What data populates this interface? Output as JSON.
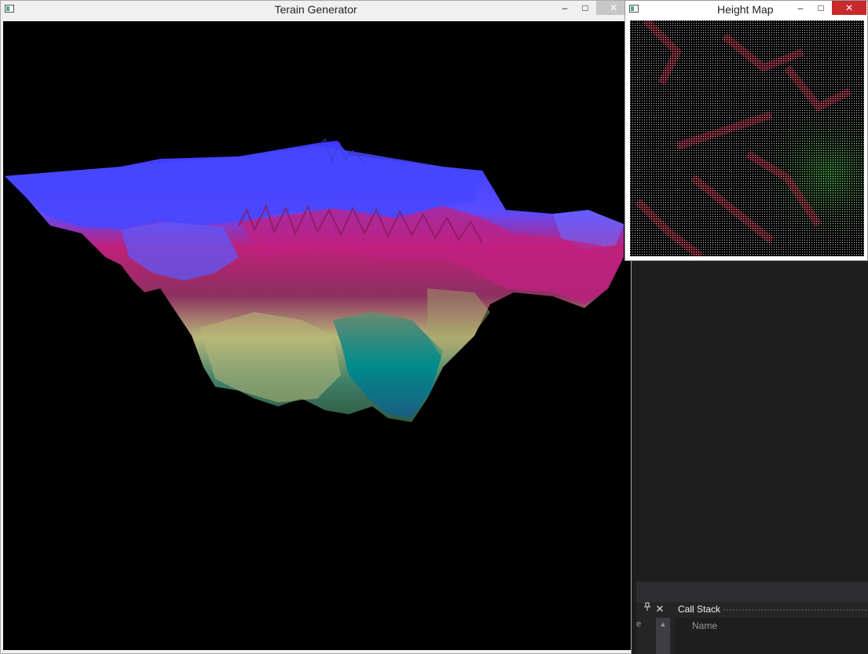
{
  "terrain_window": {
    "title": "Terain Generator",
    "minimize": "‒",
    "maximize": "□",
    "close": "✕"
  },
  "heightmap_window": {
    "title": "Height Map",
    "minimize": "‒",
    "maximize": "□",
    "close": "✕"
  },
  "ide": {
    "pin": "📌",
    "close": "✕",
    "callstack_title": "Call Stack",
    "column_name": "Name",
    "partial_label": "e"
  },
  "colors": {
    "close_active": "#c7292d",
    "close_inactive": "#c7c7c7",
    "terrain_high": "#4040ff",
    "terrain_mid": "#c0207a",
    "terrain_low": "#c0c080",
    "terrain_deep": "#008080"
  }
}
